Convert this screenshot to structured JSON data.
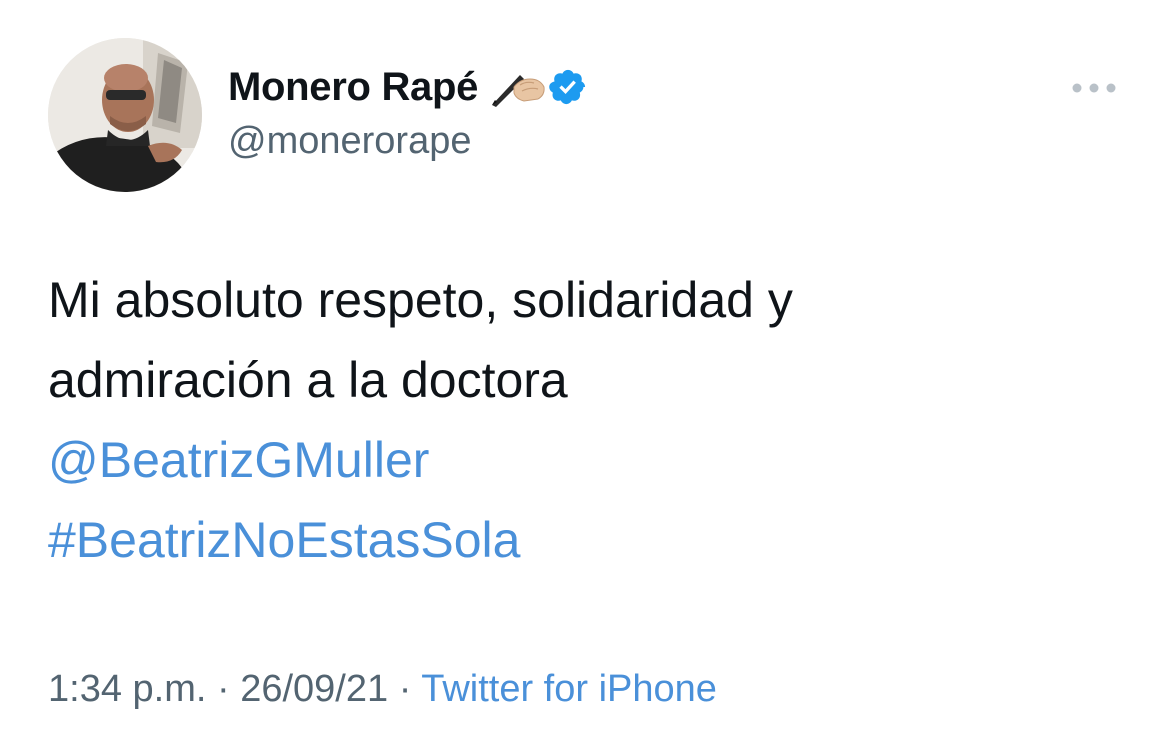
{
  "author": {
    "display_name": "Monero Rapé",
    "handle": "@monerorape",
    "name_emoji": "writing-hand-light-skin-icon",
    "verified": true
  },
  "tweet": {
    "text_lines": [
      "Mi absoluto respeto, solidaridad y",
      "admiración a la doctora"
    ],
    "mention": "@BeatrizGMuller",
    "hashtag": "#BeatrizNoEstasSola"
  },
  "meta": {
    "time": "1:34 p.m.",
    "separator": "·",
    "date": "26/09/21",
    "source": "Twitter for iPhone"
  },
  "colors": {
    "link": "#4a90d9",
    "text": "#0f1419",
    "secondary": "#536471",
    "verified": "#1d9bf0"
  },
  "icons": {
    "more": "more-horizontal-icon",
    "verified": "verified-badge-icon"
  }
}
